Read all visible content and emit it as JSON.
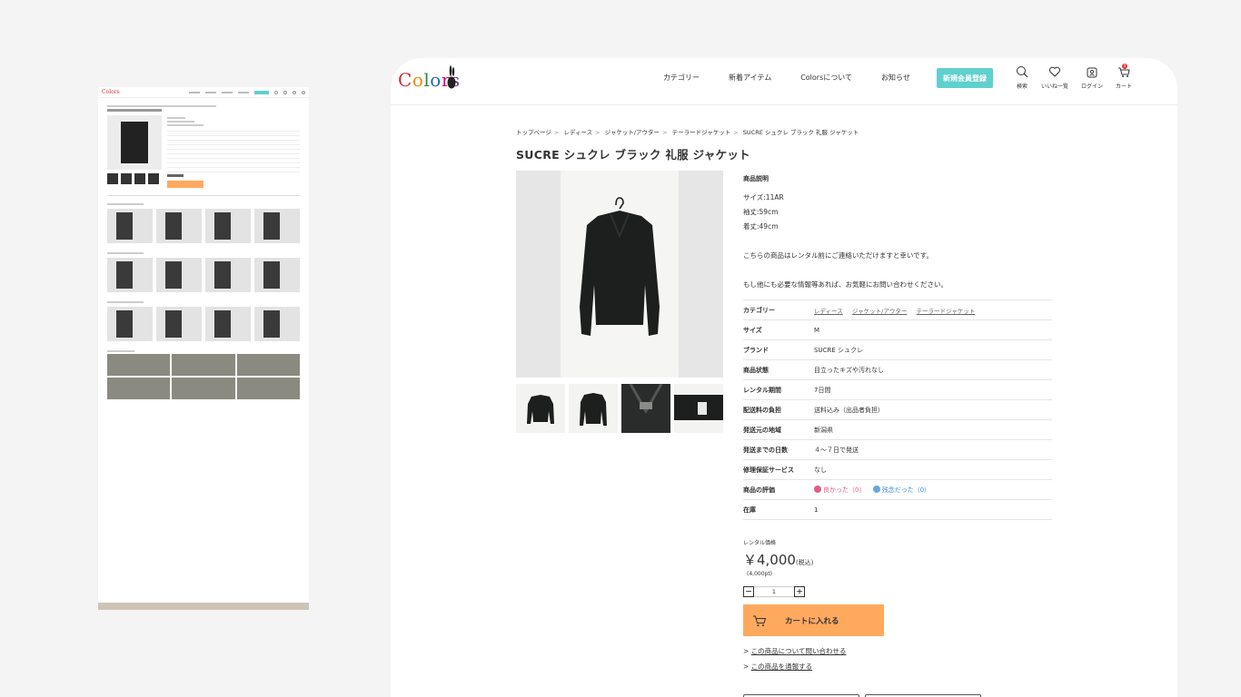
{
  "header": {
    "logo_text": "Colors",
    "nav": [
      "カテゴリー",
      "新着アイテム",
      "Colorsについて",
      "お知らせ"
    ],
    "register_label": "新規会員登録",
    "icons": [
      {
        "name": "search-icon",
        "label": "検索"
      },
      {
        "name": "heart-icon",
        "label": "いいね一覧"
      },
      {
        "name": "user-icon",
        "label": "ログイン"
      },
      {
        "name": "cart-icon",
        "label": "カート"
      }
    ],
    "cart_count": "0"
  },
  "breadcrumb": [
    "トップページ",
    "レディース",
    "ジャケット/アウター",
    "テーラードジャケット",
    "SUCRE シュクレ ブラック 礼服 ジャケット"
  ],
  "product": {
    "title": "SUCRE シュクレ ブラック 礼服 ジャケット",
    "description_title": "商品説明",
    "description": {
      "line1": "サイズ:11AR",
      "line2": "袖丈:59cm",
      "line3": "着丈:49cm",
      "line4": "こちらの商品はレンタル前にご連絡いただけますと幸いです。",
      "line5": "もし他にも必要な情報等あれば、お気軽にお問い合わせください。"
    },
    "specs": {
      "category_label": "カテゴリー",
      "category_links": [
        "レディース",
        "ジャケット/アウター",
        "テーラードジャケット"
      ],
      "size_label": "サイズ",
      "size": "M",
      "brand_label": "ブランド",
      "brand": "SUCRE シュクレ",
      "condition_label": "商品状態",
      "condition": "目立ったキズや汚れなし",
      "period_label": "レンタル期間",
      "period": "7日間",
      "shipping_label": "配送料の負担",
      "shipping": "送料込み（出品者負担）",
      "origin_label": "発送元の地域",
      "origin": "新潟県",
      "days_label": "発送までの日数",
      "days": "４〜７日で発送",
      "repair_label": "修理保証サービス",
      "repair": "なし",
      "rating_label": "商品の評価",
      "rating_good": "良かった（0）",
      "rating_bad": "残念だった（0）",
      "stock_label": "在庫",
      "stock": "1"
    },
    "price_label": "レンタル価格",
    "price": "￥4,000",
    "tax": "(税込)",
    "points": "(4,000pt)",
    "quantity": "1",
    "cart_button": "カートに入れる",
    "links": [
      "この商品について問い合わせる",
      "この商品を通報する"
    ]
  },
  "colors": {
    "accent": "#5fd0ce",
    "cart": "#ffa95f",
    "good": "#e05b8a",
    "bad": "#3d8fd6"
  }
}
